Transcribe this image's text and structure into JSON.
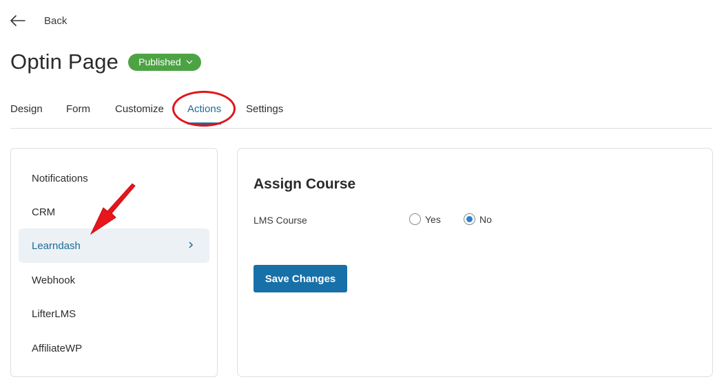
{
  "header": {
    "back_label": "Back",
    "back_icon": "arrow-left-icon",
    "title": "Optin Page",
    "status": {
      "label": "Published",
      "color": "#4da344",
      "icon": "chevron-down-icon"
    }
  },
  "tabs": [
    {
      "label": "Design",
      "active": false
    },
    {
      "label": "Form",
      "active": false
    },
    {
      "label": "Customize",
      "active": false
    },
    {
      "label": "Actions",
      "active": true
    },
    {
      "label": "Settings",
      "active": false
    }
  ],
  "accent_color": "#1e6a97",
  "sidebar": {
    "items": [
      {
        "label": "Notifications",
        "active": false
      },
      {
        "label": "CRM",
        "active": false
      },
      {
        "label": "Learndash",
        "active": true,
        "icon": "chevron-right-icon"
      },
      {
        "label": "Webhook",
        "active": false
      },
      {
        "label": "LifterLMS",
        "active": false
      },
      {
        "label": "AffiliateWP",
        "active": false
      }
    ]
  },
  "main": {
    "section_title": "Assign Course",
    "field": {
      "label": "LMS Course",
      "options": [
        {
          "label": "Yes",
          "checked": false
        },
        {
          "label": "No",
          "checked": true
        }
      ]
    },
    "save_label": "Save Changes"
  },
  "annotations": {
    "highlight_color": "#e0151b",
    "circled_tab": "Actions",
    "arrow_target": "Learndash"
  }
}
